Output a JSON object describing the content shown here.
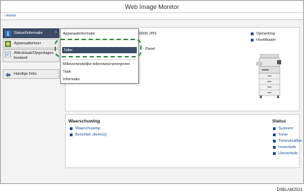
{
  "app": {
    "title": "Web Image Monitor"
  },
  "nav": {
    "home": "‹ Home"
  },
  "sidebar": {
    "items": [
      {
        "label": "Status/Informatie",
        "icon": "info-icon",
        "arrow": "›"
      },
      {
        "label": "Apparaatbeheer",
        "icon": "device-management-icon"
      },
      {
        "label": "Afdruktaak/Opgeslagen bestand",
        "icon": "document-icon"
      },
      {
        "label": "Handige links",
        "icon": "links-icon"
      }
    ]
  },
  "menu": {
    "items": [
      {
        "label": "Apparaatinformatie"
      },
      {
        "label": "Teller"
      },
      {
        "label": "Milieuvriendelijke tellerstand weergeven"
      },
      {
        "label": "Taak"
      },
      {
        "label": "Informatie"
      }
    ]
  },
  "main": {
    "model": "C6000 JPN",
    "panel": "- Panel",
    "legend": [
      {
        "label": "Opmerking"
      },
      {
        "label": "Hoofdsaam"
      }
    ]
  },
  "warnings": {
    "title": "Waarschuwing",
    "items": [
      {
        "label": "Waarschuwing"
      },
      {
        "label": "Berichten (Item(s))"
      }
    ]
  },
  "status": {
    "title": "Status",
    "items": [
      {
        "label": "Systeem"
      },
      {
        "label": "Toner"
      },
      {
        "label": "Tonerafvalfles"
      },
      {
        "label": "Invoerlade"
      },
      {
        "label": "Uitvoerlade"
      }
    ]
  },
  "caption": "D0BLAM2531",
  "colors": {
    "active": "#3d4c66",
    "link": "#1a4a9c",
    "highlight": "#2e8b3e"
  }
}
